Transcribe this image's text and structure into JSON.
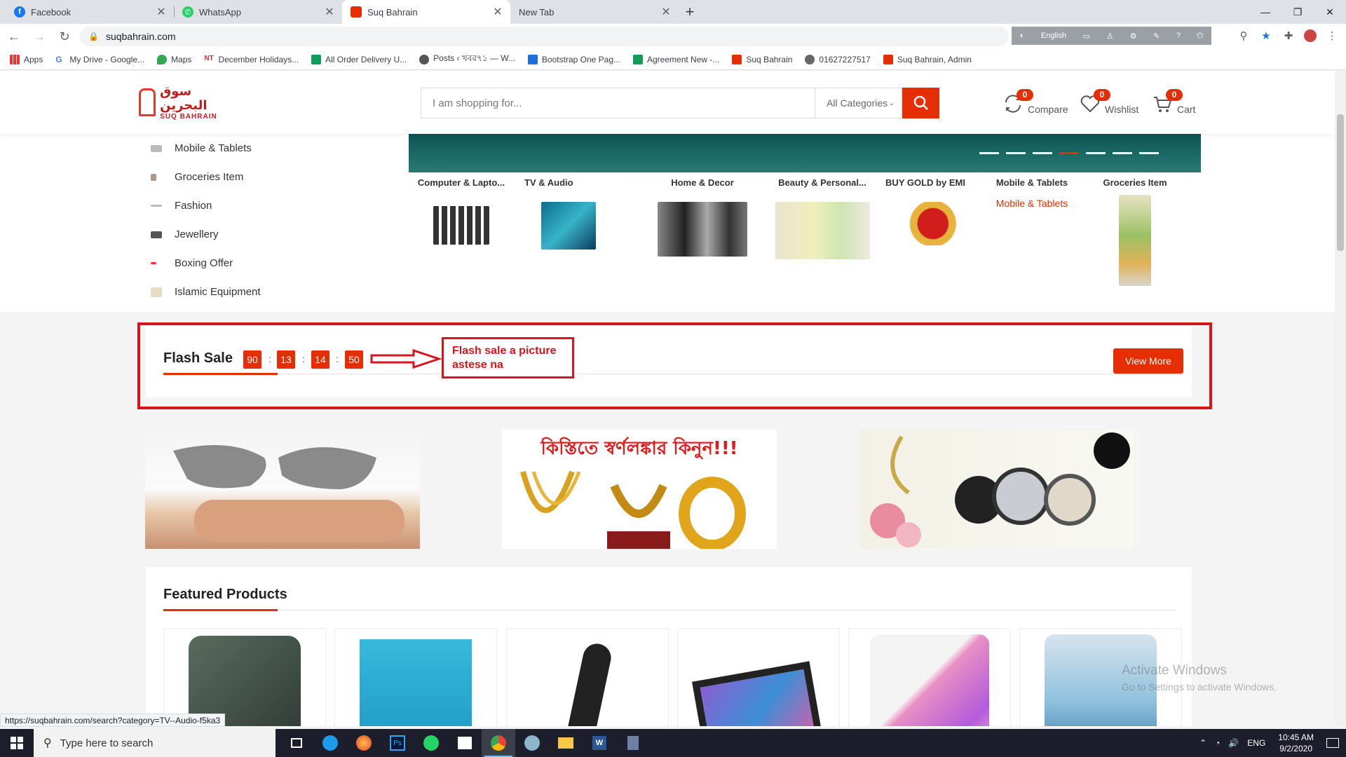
{
  "browser": {
    "tabs": [
      {
        "title": "Facebook",
        "icon": "facebook-icon",
        "color": "#1877f2",
        "active": false
      },
      {
        "title": "WhatsApp",
        "icon": "whatsapp-icon",
        "color": "#25d366",
        "active": false
      },
      {
        "title": "Suq Bahrain",
        "icon": "suq-bahrain-icon",
        "color": "#e62e04",
        "active": true
      },
      {
        "title": "New Tab",
        "icon": "",
        "color": "",
        "active": false
      }
    ],
    "url": "suqbahrain.com",
    "ext_language": "English",
    "bookmarks": [
      {
        "label": "Apps",
        "icon": "apps-grid-icon"
      },
      {
        "label": "My Drive - Google...",
        "icon": "google-icon"
      },
      {
        "label": "Maps",
        "icon": "maps-pin-icon"
      },
      {
        "label": "December Holidays...",
        "icon": "nt-icon"
      },
      {
        "label": "All Order Delivery U...",
        "icon": "sheets-icon"
      },
      {
        "label": "Posts ‹ খবর৭১ — W...",
        "icon": "globe-icon"
      },
      {
        "label": "Bootstrap One Pag...",
        "icon": "bootstrap-icon"
      },
      {
        "label": "Agreement New -...",
        "icon": "sheets-icon"
      },
      {
        "label": "Suq Bahrain",
        "icon": "suq-bahrain-icon"
      },
      {
        "label": "01627227517",
        "icon": "wordpress-icon"
      },
      {
        "label": "Suq Bahrain, Admin",
        "icon": "suq-bahrain-icon"
      }
    ]
  },
  "site": {
    "logo_ar": "سوق البحرين",
    "logo_en": "SUQ BAHRAIN",
    "search_placeholder": "I am shopping for...",
    "category_select": "All Categories",
    "compare": {
      "label": "Compare",
      "count": "0"
    },
    "wishlist": {
      "label": "Wishlist",
      "count": "0"
    },
    "cart": {
      "label": "Cart",
      "count": "0"
    },
    "accent": "#e62e04",
    "sidebar_categories": [
      "Mobile & Tablets",
      "Groceries Item",
      "Fashion",
      "Jewellery",
      "Boxing Offer",
      "Islamic Equipment"
    ],
    "featured_categories": [
      {
        "title": "Computer & Lapto..."
      },
      {
        "title": "TV & Audio"
      },
      {
        "title": "Home & Decor"
      },
      {
        "title": "Beauty & Personal..."
      },
      {
        "title": "BUY GOLD by EMI"
      },
      {
        "title": "Mobile & Tablets",
        "broken_image_alt": "Mobile & Tablets"
      },
      {
        "title": "Groceries Item"
      }
    ],
    "flash_sale": {
      "title": "Flash Sale",
      "timer": [
        "90",
        "13",
        "14",
        "50"
      ],
      "separator": ":",
      "view_more": "View More"
    },
    "annotation": "Flash sale a picture astese na",
    "promo_banner_text": "কিস্তিতে স্বর্ণলঙ্কার কিনুন!!!",
    "featured_products_title": "Featured Products"
  },
  "status_url": "https://suqbahrain.com/search?category=TV--Audio-f5ka3",
  "watermark": {
    "line1": "Activate Windows",
    "line2": "Go to Settings to activate Windows."
  },
  "taskbar": {
    "search_placeholder": "Type here to search",
    "language": "ENG",
    "time": "10:45 AM",
    "date": "9/2/2020"
  }
}
